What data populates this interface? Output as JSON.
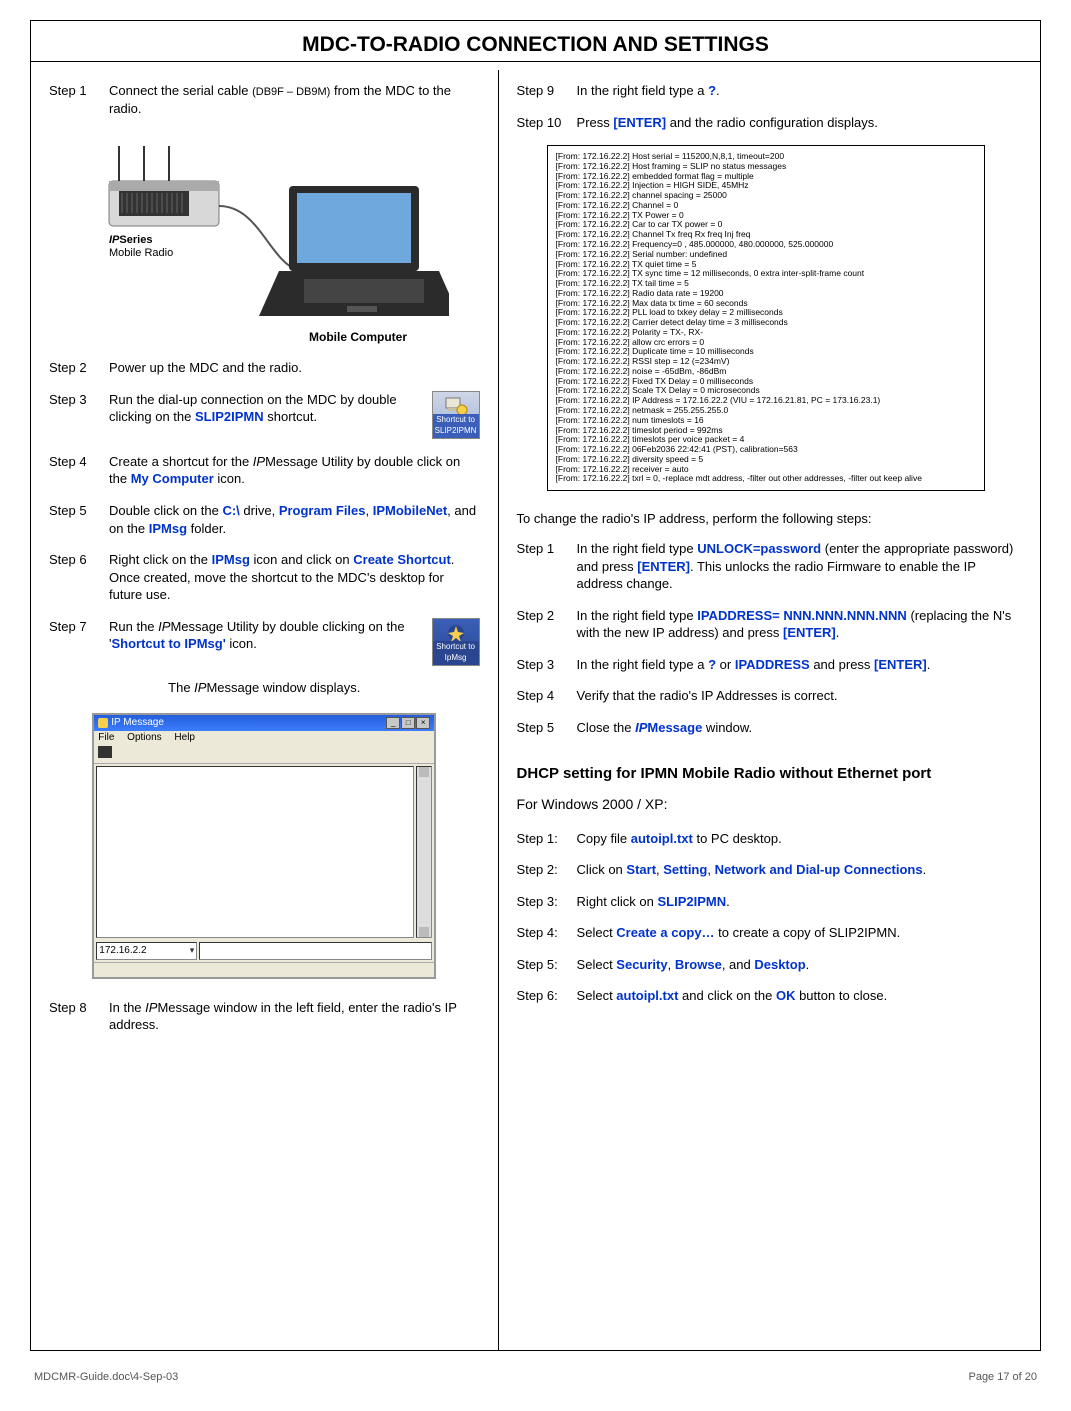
{
  "title": "MDC-TO-RADIO CONNECTION AND SETTINGS",
  "left": {
    "s1": {
      "label": "Step 1",
      "t1": "Connect the serial cable ",
      "db": "(DB9F – DB9M)",
      "t2": " from the MDC to the radio."
    },
    "fig": {
      "radio_label_i": "IP",
      "radio_label_rest": "Series",
      "radio_sub": "Mobile Radio",
      "mc": "Mobile Computer"
    },
    "s2": {
      "label": "Step 2",
      "text": "Power up the MDC and the radio."
    },
    "s3": {
      "label": "Step 3",
      "t1": "Run the dial-up connection on the MDC by double clicking on the ",
      "link": "SLIP2IPMN",
      "t2": " shortcut."
    },
    "slip_caption": "Shortcut to SLIP2IPMN",
    "s4": {
      "label": "Step 4",
      "t1": "Create a shortcut for the ",
      "ip": "IP",
      "t2": "Message Utility by double click on the ",
      "link": "My Computer",
      "t3": " icon."
    },
    "s5": {
      "label": "Step 5",
      "t1": "Double click on the ",
      "l1": "C:\\",
      "t2": " drive, ",
      "l2": "Program Files",
      "t3": ", ",
      "l3": "IPMobileNet",
      "t4": ", and on the ",
      "l4": "IPMsg",
      "t5": " folder."
    },
    "s6": {
      "label": "Step 6",
      "t1": "Right click on the ",
      "l1": "IPMsg",
      "t2": " icon and click on ",
      "l2": "Create Shortcut",
      "t3": ".  Once created, move the shortcut to the MDC's desktop for future use."
    },
    "s7": {
      "label": "Step 7",
      "t1": "Run the ",
      "ip": "IP",
      "t2": "Message Utility by double clicking on the '",
      "link": "Shortcut to IPMsg'",
      "t3": " icon."
    },
    "ipmsg_caption": "Shortcut to IpMsg",
    "caption": {
      "pre": "The ",
      "ip": "IP",
      "post": "Message window displays."
    },
    "window": {
      "title": "IP Message",
      "menus": [
        "File",
        "Options",
        "Help"
      ],
      "ip": "172.16.2.2"
    },
    "s8": {
      "label": "Step 8",
      "t1": "In the ",
      "ip": "IP",
      "t2": "Message window in the left field, enter the radio's IP address."
    }
  },
  "right": {
    "s9": {
      "label": "Step 9",
      "t1": " In the right field type a ",
      "q": "?",
      "t2": "."
    },
    "s10": {
      "label": "Step 10",
      "t1": "Press ",
      "l1": "[ENTER]",
      "t2": " and the radio configuration displays."
    },
    "config_lines": [
      "[From: 172.16.22.2] Host serial = 115200,N,8,1, timeout=200",
      "[From: 172.16.22.2] Host framing = SLIP no status messages",
      "[From: 172.16.22.2] embedded format flag = multiple",
      "[From: 172.16.22.2] Injection = HIGH SIDE, 45MHz",
      "[From: 172.16.22.2] channel spacing = 25000",
      "[From: 172.16.22.2] Channel = 0",
      "[From: 172.16.22.2] TX Power = 0",
      "[From: 172.16.22.2] Car to car TX power = 0",
      "[From: 172.16.22.2]             Channel       Tx freq        Rx freq       Inj freq",
      "[From: 172.16.22.2] Frequency=0      ,    485.000000,    480.000000,    525.000000",
      "[From: 172.16.22.2] Serial number: undefined",
      "[From: 172.16.22.2] TX quiet time = 5",
      "[From: 172.16.22.2] TX sync time = 12 milliseconds, 0 extra inter-split-frame count",
      "[From: 172.16.22.2] TX tail time = 5",
      "[From: 172.16.22.2] Radio data rate = 19200",
      "[From: 172.16.22.2] Max data tx time = 60 seconds",
      "[From: 172.16.22.2] PLL load to txkey delay = 2 milliseconds",
      "[From: 172.16.22.2] Carrier detect delay time = 3 milliseconds",
      "[From: 172.16.22.2] Polarity = TX-, RX-",
      "[From: 172.16.22.2] allow crc errors = 0",
      "[From: 172.16.22.2] Duplicate time = 10 milliseconds",
      "[From: 172.16.22.2] RSSI step = 12   (=234mV)",
      "[From: 172.16.22.2] noise = -65dBm, -86dBm",
      "[From: 172.16.22.2] Fixed TX Delay = 0 milliseconds",
      "[From: 172.16.22.2] Scale TX Delay = 0 microseconds",
      "[From: 172.16.22.2] IP Address = 172.16.22.2 (VIU = 172.16.21.81, PC = 173.16.23.1)",
      "[From: 172.16.22.2] netmask = 255.255.255.0",
      "[From: 172.16.22.2] num timeslots = 16",
      "[From: 172.16.22.2] timeslot period = 992ms",
      "[From: 172.16.22.2] timeslots per voice packet = 4",
      "[From: 172.16.22.2] 06Feb2036 22:42:41 (PST), calibration=563",
      "[From: 172.16.22.2] diversity speed = 5",
      "[From: 172.16.22.2] receiver = auto",
      "[From: 172.16.22.2] txrl = 0, -replace mdt address, -filter out other addresses, -filter out keep alive"
    ],
    "change_ip_intro": "To change the radio's IP address, perform the following steps:",
    "cs1": {
      "label": "Step 1",
      "t1": "In the right field type ",
      "l1": "UNLOCK=password",
      "t2": " (enter the appropriate password) and press ",
      "l2": "[ENTER]",
      "t3": ".  This unlocks the radio Firmware to enable the IP address change."
    },
    "cs2": {
      "label": "Step 2",
      "t1": "In the right field type ",
      "l1": "IPADDRESS= NNN.NNN.NNN.NNN",
      "t2": " (replacing the N's with the new IP address) and press ",
      "l2": "[ENTER]",
      "t3": "."
    },
    "cs3": {
      "label": "Step 3",
      "t1": "In the right field type a ",
      "l1": "?",
      "t2": " or ",
      "l2": "IPADDRESS",
      "t3": " and press ",
      "l3": "[ENTER]",
      "t4": "."
    },
    "cs4": {
      "label": "Step 4",
      "t1": " Verify that the radio's IP Addresses is correct."
    },
    "cs5": {
      "label": "Step 5",
      "t1": " Close the ",
      "ip": "IP",
      "l1": "Message",
      "t2": " window."
    },
    "dhcp_heading": "DHCP setting for IPMN Mobile Radio without Ethernet port",
    "os_line": "For Windows 2000 / XP:",
    "d1": {
      "label": "Step 1:",
      "t1": "Copy file ",
      "l1": "autoipl.txt",
      "t2": " to PC desktop."
    },
    "d2": {
      "label": "Step 2:",
      "t1": "Click on ",
      "l1": "Start",
      "t2": ", ",
      "l2": "Setting",
      "t3": ", ",
      "l3": "Network and Dial-up Connections",
      "t4": "."
    },
    "d3": {
      "label": "Step 3:",
      "t1": " Right click on ",
      "l1": "SLIP2IPMN",
      "t2": "."
    },
    "d4": {
      "label": "Step 4:",
      "t1": "Select ",
      "l1": "Create a copy…",
      "t2": " to create a copy of SLIP2IPMN."
    },
    "d5": {
      "label": "Step 5:",
      "t1": " Select ",
      "l1": "Security",
      "t2": ", ",
      "l2": "Browse",
      "t3": ", and ",
      "l3": "Desktop",
      "t4": "."
    },
    "d6": {
      "label": "Step 6:",
      "t1": "Select ",
      "l1": "autoipl.txt",
      "t2": " and click on the ",
      "l2": "OK",
      "t3": " button to close."
    }
  },
  "footer": {
    "left": "MDCMR-Guide.doc\\4-Sep-03",
    "right": "Page 17 of 20"
  }
}
